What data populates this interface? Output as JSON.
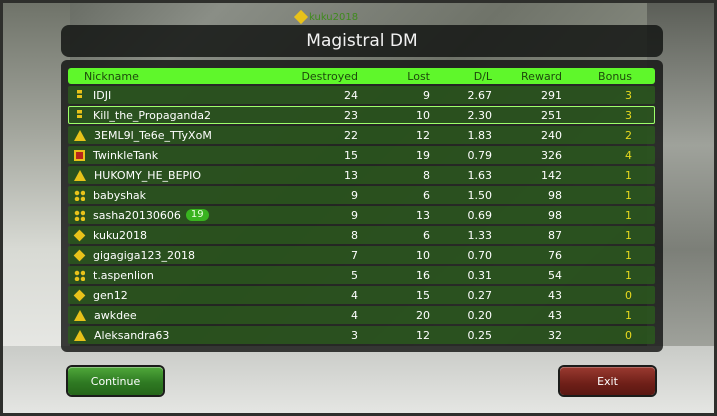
{
  "player": {
    "name": "kuku2018"
  },
  "title": "Magistral DM",
  "columns": {
    "nickname": "Nickname",
    "destroyed": "Destroyed",
    "lost": "Lost",
    "dl": "D/L",
    "reward": "Reward",
    "bonus": "Bonus"
  },
  "rows": [
    {
      "rank": "bars",
      "nickname": "IDJI",
      "gs": "",
      "destroyed": "24",
      "lost": "9",
      "dl": "2.67",
      "reward": "291",
      "bonus": "3"
    },
    {
      "rank": "bars",
      "nickname": "Kill_the_Propaganda2",
      "gs": "",
      "destroyed": "23",
      "lost": "10",
      "dl": "2.30",
      "reward": "251",
      "bonus": "3"
    },
    {
      "rank": "tri",
      "nickname": "3EML9l_Te6e_TTyXoM",
      "gs": "",
      "destroyed": "22",
      "lost": "12",
      "dl": "1.83",
      "reward": "240",
      "bonus": "2"
    },
    {
      "rank": "red",
      "nickname": "TwinkleTank",
      "gs": "",
      "destroyed": "15",
      "lost": "19",
      "dl": "0.79",
      "reward": "326",
      "bonus": "4"
    },
    {
      "rank": "tri",
      "nickname": "HUKOMY_HE_BEPIO",
      "gs": "",
      "destroyed": "13",
      "lost": "8",
      "dl": "1.63",
      "reward": "142",
      "bonus": "1"
    },
    {
      "rank": "grid",
      "nickname": "babyshak",
      "gs": "",
      "destroyed": "9",
      "lost": "6",
      "dl": "1.50",
      "reward": "98",
      "bonus": "1"
    },
    {
      "rank": "grid",
      "nickname": "sasha20130606",
      "gs": "19",
      "destroyed": "9",
      "lost": "13",
      "dl": "0.69",
      "reward": "98",
      "bonus": "1"
    },
    {
      "rank": "diamond",
      "nickname": "kuku2018",
      "gs": "",
      "destroyed": "8",
      "lost": "6",
      "dl": "1.33",
      "reward": "87",
      "bonus": "1"
    },
    {
      "rank": "diamond",
      "nickname": "gigagiga123_2018",
      "gs": "",
      "destroyed": "7",
      "lost": "10",
      "dl": "0.70",
      "reward": "76",
      "bonus": "1"
    },
    {
      "rank": "grid",
      "nickname": "t.aspenlion",
      "gs": "",
      "destroyed": "5",
      "lost": "16",
      "dl": "0.31",
      "reward": "54",
      "bonus": "1"
    },
    {
      "rank": "diamond",
      "nickname": "gen12",
      "gs": "",
      "destroyed": "4",
      "lost": "15",
      "dl": "0.27",
      "reward": "43",
      "bonus": "0"
    },
    {
      "rank": "tri",
      "nickname": "awkdee",
      "gs": "",
      "destroyed": "4",
      "lost": "20",
      "dl": "0.20",
      "reward": "43",
      "bonus": "1"
    },
    {
      "rank": "tri",
      "nickname": "Aleksandra63",
      "gs": "",
      "destroyed": "3",
      "lost": "12",
      "dl": "0.25",
      "reward": "32",
      "bonus": "0"
    }
  ],
  "selected_row": 1,
  "buttons": {
    "continue": "Continue",
    "exit": "Exit"
  }
}
